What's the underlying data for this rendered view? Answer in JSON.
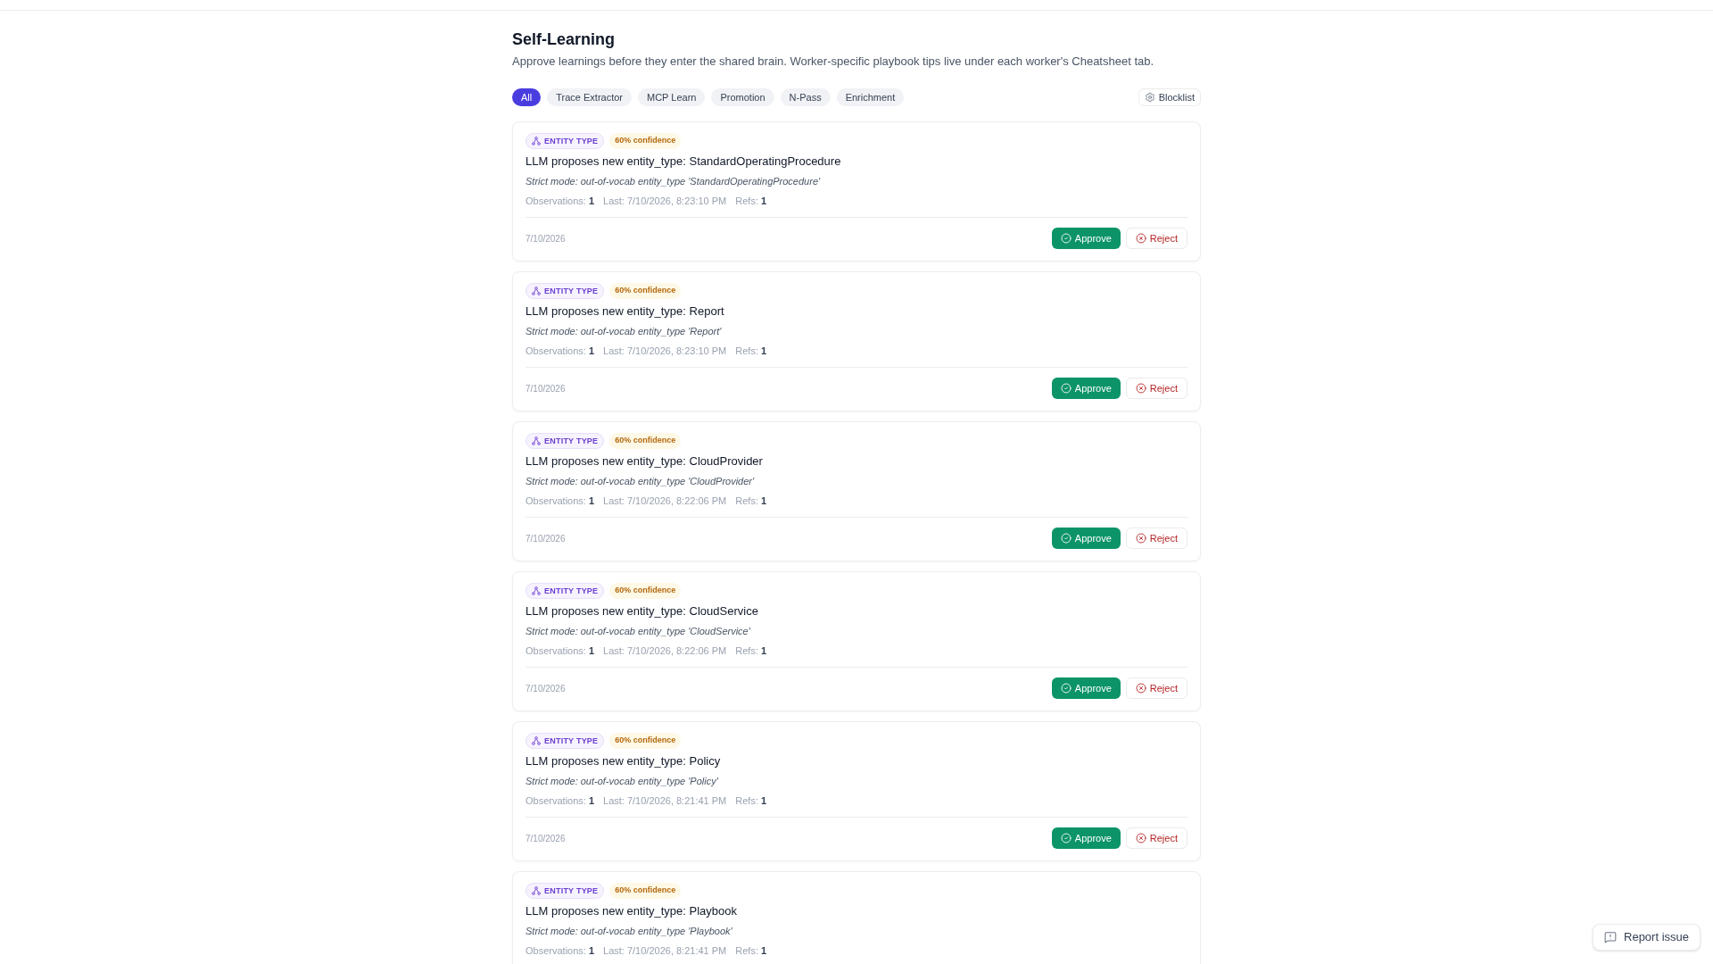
{
  "page": {
    "title": "Self-Learning",
    "description": "Approve learnings before they enter the shared brain. Worker-specific playbook tips live under each worker's Cheatsheet tab."
  },
  "filters": [
    {
      "label": "All",
      "selected": true
    },
    {
      "label": "Trace Extractor",
      "selected": false
    },
    {
      "label": "MCP Learn",
      "selected": false
    },
    {
      "label": "Promotion",
      "selected": false
    },
    {
      "label": "N-Pass",
      "selected": false
    },
    {
      "label": "Enrichment",
      "selected": false
    }
  ],
  "blocklist_button": {
    "label": "Blocklist"
  },
  "learnings": [
    {
      "type_tag": "ENTITY TYPE",
      "confidence": "60% confidence",
      "title": "LLM proposes new entity_type: StandardOperatingProcedure",
      "detail": "Strict mode: out-of-vocab entity_type 'StandardOperatingProcedure'",
      "observations": "Observations: **1**",
      "last_seen": "Last: 7/10/2026, 8:23:10 PM",
      "refs": "Refs: **1**",
      "date": "7/10/2026",
      "actions": [
        {
          "kind": "approve",
          "label": "Approve"
        },
        {
          "kind": "reject",
          "label": "Reject"
        }
      ]
    },
    {
      "type_tag": "ENTITY TYPE",
      "confidence": "60% confidence",
      "title": "LLM proposes new entity_type: Report",
      "detail": "Strict mode: out-of-vocab entity_type 'Report'",
      "observations": "Observations: **1**",
      "last_seen": "Last: 7/10/2026, 8:23:10 PM",
      "refs": "Refs: **1**",
      "date": "7/10/2026",
      "actions": [
        {
          "kind": "approve",
          "label": "Approve"
        },
        {
          "kind": "reject",
          "label": "Reject"
        }
      ]
    },
    {
      "type_tag": "ENTITY TYPE",
      "confidence": "60% confidence",
      "title": "LLM proposes new entity_type: CloudProvider",
      "detail": "Strict mode: out-of-vocab entity_type 'CloudProvider'",
      "observations": "Observations: **1**",
      "last_seen": "Last: 7/10/2026, 8:22:06 PM",
      "refs": "Refs: **1**",
      "date": "7/10/2026",
      "actions": [
        {
          "kind": "approve",
          "label": "Approve"
        },
        {
          "kind": "reject",
          "label": "Reject"
        }
      ]
    },
    {
      "type_tag": "ENTITY TYPE",
      "confidence": "60% confidence",
      "title": "LLM proposes new entity_type: CloudService",
      "detail": "Strict mode: out-of-vocab entity_type 'CloudService'",
      "observations": "Observations: **1**",
      "last_seen": "Last: 7/10/2026, 8:22:06 PM",
      "refs": "Refs: **1**",
      "date": "7/10/2026",
      "actions": [
        {
          "kind": "approve",
          "label": "Approve"
        },
        {
          "kind": "reject",
          "label": "Reject"
        }
      ]
    },
    {
      "type_tag": "ENTITY TYPE",
      "confidence": "60% confidence",
      "title": "LLM proposes new entity_type: Policy",
      "detail": "Strict mode: out-of-vocab entity_type 'Policy'",
      "observations": "Observations: **1**",
      "last_seen": "Last: 7/10/2026, 8:21:41 PM",
      "refs": "Refs: **1**",
      "date": "7/10/2026",
      "actions": [
        {
          "kind": "approve",
          "label": "Approve"
        },
        {
          "kind": "reject",
          "label": "Reject"
        }
      ]
    },
    {
      "type_tag": "ENTITY TYPE",
      "confidence": "60% confidence",
      "title": "LLM proposes new entity_type: Playbook",
      "detail": "Strict mode: out-of-vocab entity_type 'Playbook'",
      "observations": "Observations: **1**",
      "last_seen": "Last: 7/10/2026, 8:21:41 PM",
      "refs": "Refs: **1**"
    }
  ],
  "report_button": {
    "label": "Report issue"
  }
}
